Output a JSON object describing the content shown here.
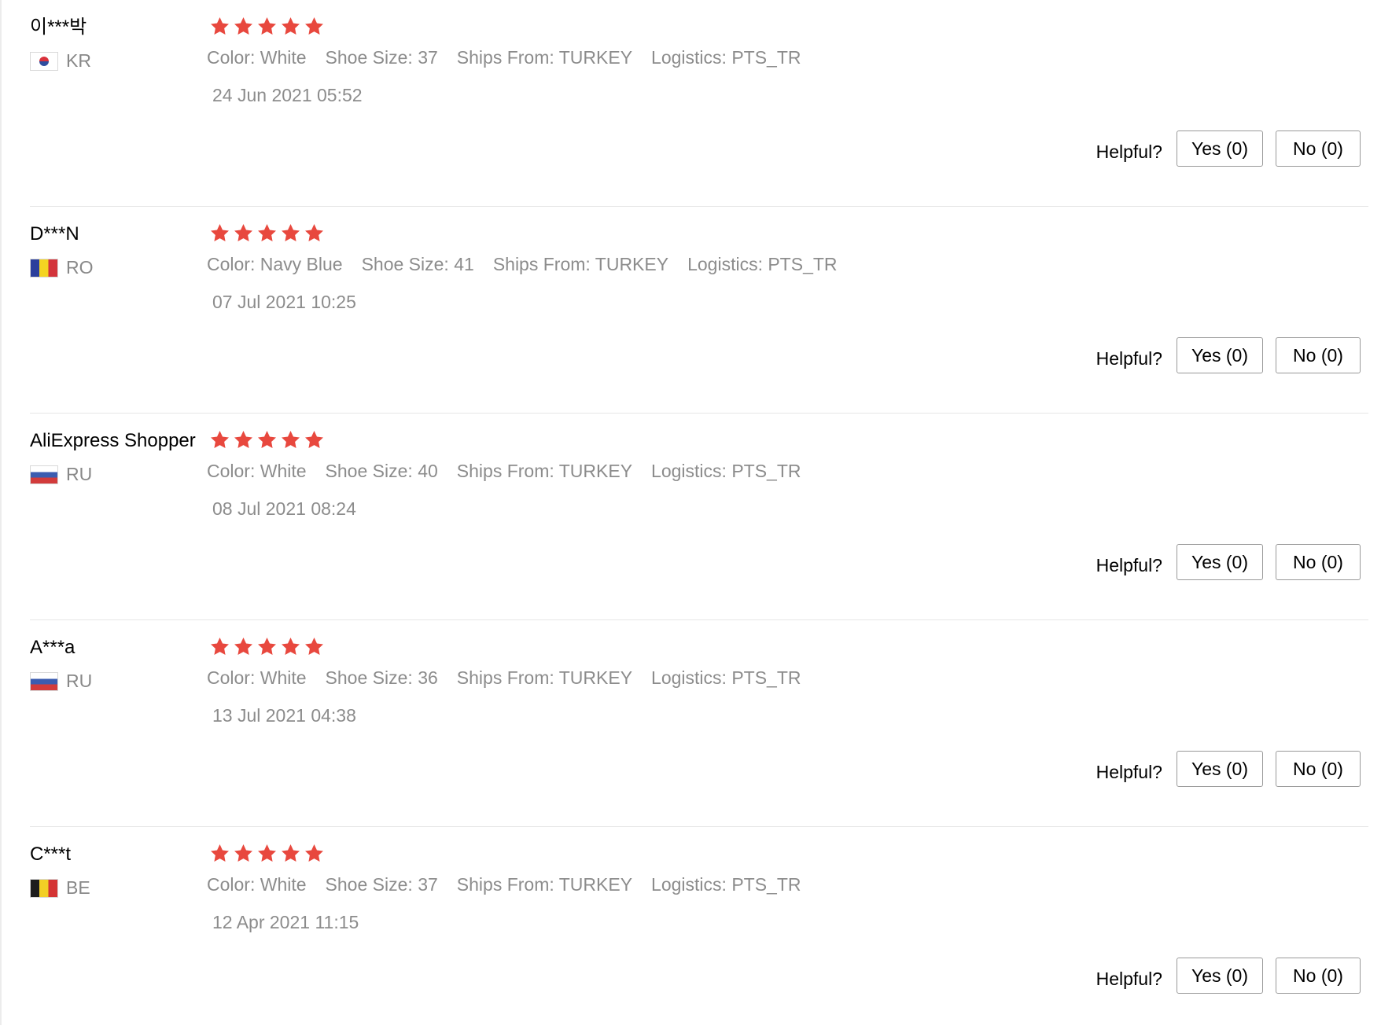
{
  "reviews": [
    {
      "user": "이***박",
      "country": "KR",
      "flag": "kr-flag-icon",
      "rating": 5,
      "attrs": [
        {
          "label": "Color:",
          "value": "White"
        },
        {
          "label": "Shoe Size:",
          "value": "37"
        },
        {
          "label": "Ships From:",
          "value": "TURKEY"
        },
        {
          "label": "Logistics:",
          "value": "PTS_TR"
        }
      ],
      "date": "24 Jun 2021 05:52",
      "helpful_label": "Helpful?",
      "yes_label": "Yes (0)",
      "no_label": "No (0)"
    },
    {
      "user": "D***N",
      "country": "RO",
      "flag": "ro-flag-icon",
      "rating": 5,
      "attrs": [
        {
          "label": "Color:",
          "value": "Navy Blue"
        },
        {
          "label": "Shoe Size:",
          "value": "41"
        },
        {
          "label": "Ships From:",
          "value": "TURKEY"
        },
        {
          "label": "Logistics:",
          "value": "PTS_TR"
        }
      ],
      "date": "07 Jul 2021 10:25",
      "helpful_label": "Helpful?",
      "yes_label": "Yes (0)",
      "no_label": "No (0)"
    },
    {
      "user": "AliExpress Shopper",
      "country": "RU",
      "flag": "ru-flag-icon",
      "rating": 5,
      "attrs": [
        {
          "label": "Color:",
          "value": "White"
        },
        {
          "label": "Shoe Size:",
          "value": "40"
        },
        {
          "label": "Ships From:",
          "value": "TURKEY"
        },
        {
          "label": "Logistics:",
          "value": "PTS_TR"
        }
      ],
      "date": "08 Jul 2021 08:24",
      "helpful_label": "Helpful?",
      "yes_label": "Yes (0)",
      "no_label": "No (0)"
    },
    {
      "user": "A***a",
      "country": "RU",
      "flag": "ru-flag-icon",
      "rating": 5,
      "attrs": [
        {
          "label": "Color:",
          "value": "White"
        },
        {
          "label": "Shoe Size:",
          "value": "36"
        },
        {
          "label": "Ships From:",
          "value": "TURKEY"
        },
        {
          "label": "Logistics:",
          "value": "PTS_TR"
        }
      ],
      "date": "13 Jul 2021 04:38",
      "helpful_label": "Helpful?",
      "yes_label": "Yes (0)",
      "no_label": "No (0)"
    },
    {
      "user": "C***t",
      "country": "BE",
      "flag": "be-flag-icon",
      "rating": 5,
      "attrs": [
        {
          "label": "Color:",
          "value": "White"
        },
        {
          "label": "Shoe Size:",
          "value": "37"
        },
        {
          "label": "Ships From:",
          "value": "TURKEY"
        },
        {
          "label": "Logistics:",
          "value": "PTS_TR"
        }
      ],
      "date": "12 Apr 2021 11:15",
      "helpful_label": "Helpful?",
      "yes_label": "Yes (0)",
      "no_label": "No (0)"
    }
  ],
  "colors": {
    "star": "#e8483e",
    "muted_text": "#8c8c8c",
    "divider": "#e6e6e6"
  },
  "icons": {
    "star": "star-icon"
  }
}
